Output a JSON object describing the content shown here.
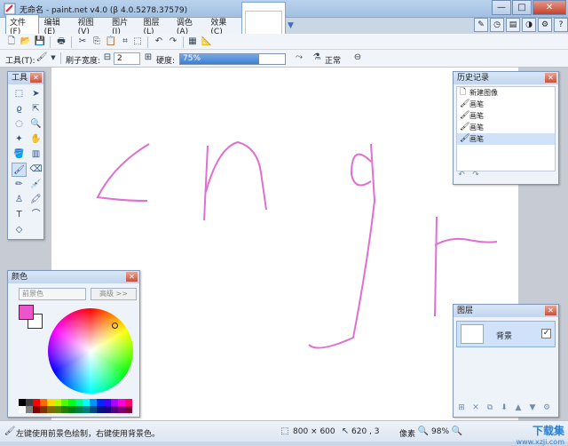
{
  "window": {
    "title": "无命名 - paint.net v4.0 (β 4.0.5278.37579)",
    "min": "—",
    "max": "□",
    "close": "✕"
  },
  "menu": {
    "items": [
      "文件(F)",
      "编辑(E)",
      "视图(V)",
      "图片(I)",
      "图层(L)",
      "调色(A)",
      "效果(C)"
    ]
  },
  "toolbar2": {
    "tool_label": "工具(T):",
    "brush_width_label": "刷子宽度:",
    "brush_width_value": "2",
    "hardness_label": "硬度:",
    "hardness_value": "75%",
    "hardness_fraction": 0.75,
    "blend_label": "正常"
  },
  "tools_panel": {
    "title": "工具",
    "close": "✕"
  },
  "history_panel": {
    "title": "历史记录",
    "close": "✕",
    "items": [
      {
        "label": "新建图像",
        "icon": "new-image-icon"
      },
      {
        "label": "画笔",
        "icon": "paintbrush-icon"
      },
      {
        "label": "画笔",
        "icon": "paintbrush-icon"
      },
      {
        "label": "画笔",
        "icon": "paintbrush-icon"
      },
      {
        "label": "画笔",
        "icon": "paintbrush-icon"
      }
    ]
  },
  "colors_panel": {
    "title": "颜色",
    "close": "✕",
    "mode": "前景色",
    "more_button": "高级 >>",
    "primary_color": "#ee55cc",
    "secondary_color": "#ffffff"
  },
  "layers_panel": {
    "title": "图层",
    "close": "✕",
    "layer_name": "背景",
    "visible_check": "✓"
  },
  "statusbar": {
    "hint": "左键使用前景色绘制，右键使用背景色。",
    "image_size": "800 × 600",
    "cursor_pos": "620 , 3",
    "unit": "像素",
    "zoom": "98%"
  },
  "watermark": {
    "line1": "下载集",
    "line2": "www.xzji.com"
  },
  "colors": {
    "stroke": "#e070d0",
    "accent": "#3f7ed0"
  }
}
